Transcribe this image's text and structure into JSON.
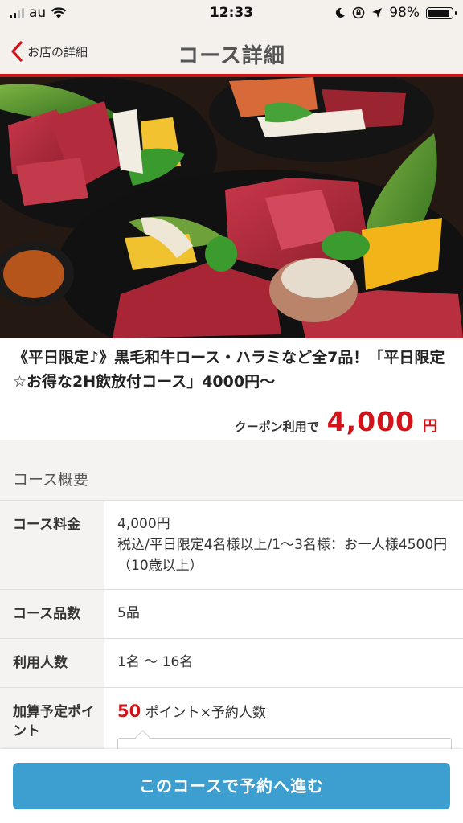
{
  "status_bar": {
    "carrier": "au",
    "time": "12:33",
    "battery": "98%"
  },
  "nav": {
    "back_label": "お店の詳細",
    "title": "コース詳細"
  },
  "course": {
    "title": "《平日限定♪》黒毛和牛ロース・ハラミなど全7品！「平日限定☆お得な2H飲放付コース」4000円〜",
    "price_label": "クーポン利用で",
    "price_value": "4,000",
    "price_unit": "円"
  },
  "summary": {
    "heading": "コース概要",
    "rows": [
      {
        "label": "コース料金",
        "value_line1": "4,000円",
        "value_line2": "税込/平日限定4名様以上/1〜3名様：お一人様4500円（10歳以上）"
      },
      {
        "label": "コース品数",
        "value": "5品"
      },
      {
        "label": "利用人数",
        "value": "1名 〜 16名"
      },
      {
        "label": "加算予定ポイント",
        "points": "50",
        "points_suffix": "ポイント×予約人数"
      }
    ]
  },
  "footer": {
    "cta_label": "このコースで予約へ進む"
  },
  "colors": {
    "accent_red": "#d3131a",
    "cta_blue": "#3d9fd0",
    "header_bg": "#f4f1ed"
  }
}
